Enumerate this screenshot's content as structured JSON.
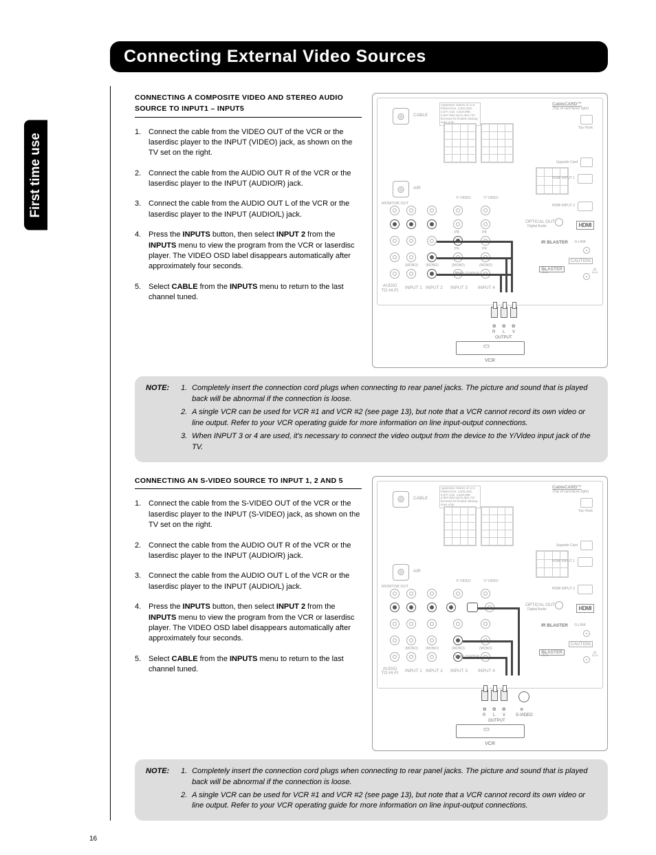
{
  "sideTab": "First time use",
  "title": "Connecting External Video Sources",
  "pageNumber": "16",
  "section1": {
    "heading": "CONNECTING A COMPOSITE VIDEO AND STEREO AUDIO SOURCE TO INPUT1 – INPUT5",
    "steps": [
      "Connect the cable from the VIDEO OUT of the VCR or the laserdisc player to the INPUT (VIDEO) jack, as shown on the TV set on the right.",
      "Connect the cable from the AUDIO OUT R of the VCR or the laserdisc player to the INPUT (AUDIO/R) jack.",
      "Connect the cable from the AUDIO OUT L of the VCR or the laserdisc player to the INPUT (AUDIO/L) jack.",
      "Press the <b>INPUTS</b> button, then select <b>INPUT 2</b> from the <b>INPUTS</b> menu to view the program from the VCR or laserdisc player. The VIDEO OSD label disappears automatically after approximately four seconds.",
      "Select <b>CABLE</b> from the <b>INPUTS</b> menu to return to the last channel tuned."
    ]
  },
  "note1": {
    "label": "NOTE:",
    "items": [
      "Completely insert the connection cord plugs when connecting to rear panel jacks. The picture and sound that is played back will be abnormal if the connection is loose.",
      "A single VCR can be used for VCR #1 and VCR #2 (see page 13), but note that a VCR cannot record its own video or line output. Refer to your VCR operating guide for more information on line input-output connections.",
      "When INPUT 3 or 4 are used, it's necessary to connect the video output from the device to the Y/Video input jack of the TV."
    ]
  },
  "section2": {
    "heading": "CONNECTING AN S-VIDEO SOURCE TO INPUT 1, 2 AND 5",
    "steps": [
      "Connect the cable from the S-VIDEO OUT of the VCR or the laserdisc player to the INPUT (S-VIDEO) jack, as shown on the TV set on the right.",
      "Connect the cable from the AUDIO OUT R of the VCR or the laserdisc player to the INPUT (AUDIO/R) jack.",
      "Connect the cable from the AUDIO OUT L of the VCR or the laserdisc player to the INPUT (AUDIO/L) jack.",
      "Press the <b>INPUTS</b> button, then select <b>INPUT 2</b> from the <b>INPUTS</b> menu to view the program from the VCR or laserdisc player. The VIDEO OSD label disappears automatically after approximately four seconds.",
      "Select <b>CABLE</b> from the <b>INPUTS</b> menu to return to the last channel tuned."
    ]
  },
  "note2": {
    "label": "NOTE:",
    "items": [
      "Completely insert the connection cord plugs when connecting to rear panel jacks. The picture and sound that is played back will be abnormal if the connection is loose.",
      "A single VCR can be used for VCR #1 and VCR #2 (see page 13), but note that a VCR cannot record its own video or line output. Refer to your VCR operating guide for more information on line input-output connections."
    ]
  },
  "diagram": {
    "cable": "CABLE",
    "air": "AIR",
    "cablecard": "CableCARD™",
    "cablecardSub": "(Top of card faces right)",
    "patent": "Apparatus Claims of U.S. Patent Nos. 4,631,603, 4,577,216, 4,819,098, 4,907,093 and 6,381,747 licensed for limited viewing uses only.",
    "upgradeCard": "Upgrade Card",
    "hdmiInput1": "HDMI INPUT 1",
    "hdmiInput2": "HDMI INPUT 2",
    "hdmi": "HDMI",
    "opticalOut": "OPTICAL OUT",
    "digitalAudio": "Digital Audio",
    "monitorOut": "MONITOR OUT",
    "irBlaster": "IR BLASTER",
    "gLink": "G-LINK",
    "caution": "CAUTION",
    "audioToHifi": "AUDIO TO HI-FI",
    "input1": "INPUT 1",
    "input2": "INPUT 2",
    "input3": "INPUT 3",
    "input4": "INPUT 4",
    "yVideo": "Y/ VIDEO",
    "pb": "PB",
    "pr": "PR",
    "mono": "(MONO)",
    "tvAsCenter": "TV AS CENTER",
    "vcr": "VCR",
    "r": "R",
    "l": "L",
    "v": "V",
    "output": "OUTPUT",
    "svideo": "S-VIDEO",
    "topHook": "Top Hook"
  }
}
